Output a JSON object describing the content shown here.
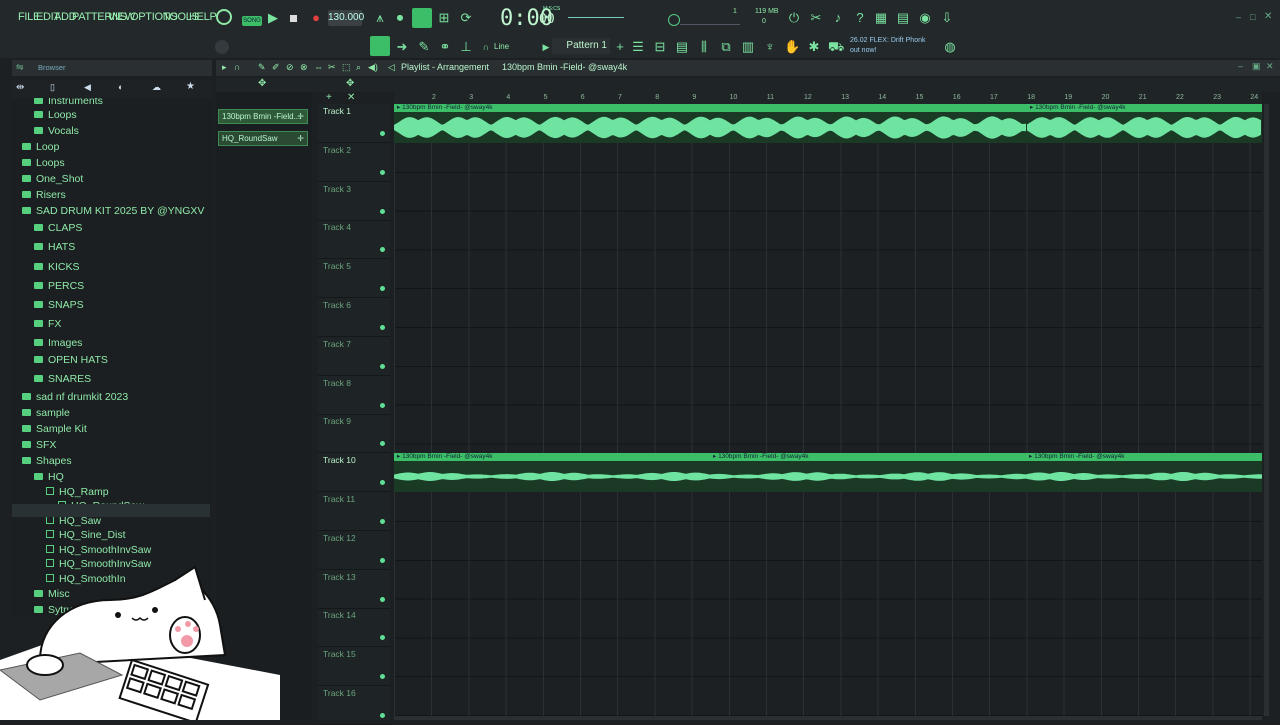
{
  "menu": [
    "FILE",
    "EDIT",
    "ADD",
    "PATTERNS",
    "VIEW",
    "OPTIONS",
    "TOOLS",
    "HELP"
  ],
  "transport": {
    "tempo": "130.000",
    "time": "0:00",
    "time_small": "00",
    "time_unit": "M:S:CS",
    "cpu": "119 MB",
    "cpu_small": "0",
    "beat": "1",
    "beat2": "0"
  },
  "pattern": "Pattern 1",
  "snap": "Line",
  "news": {
    "line1": "26.02  FLEX: Drift Phonk",
    "line2": "out now!"
  },
  "browser": {
    "title": "Browser",
    "items": [
      {
        "label": "Instruments",
        "indent": 1,
        "type": "folder"
      },
      {
        "label": "Loops",
        "indent": 1,
        "type": "folder"
      },
      {
        "label": "Vocals",
        "indent": 1,
        "type": "folder"
      },
      {
        "label": "Loop",
        "indent": 0,
        "type": "folder"
      },
      {
        "label": "Loops",
        "indent": 0,
        "type": "folder"
      },
      {
        "label": "One_Shot",
        "indent": 0,
        "type": "folder"
      },
      {
        "label": "Risers",
        "indent": 0,
        "type": "folder"
      },
      {
        "label": "SAD DRUM KIT 2025 BY @YNGXV",
        "indent": 0,
        "type": "folder"
      },
      {
        "label": "CLAPS",
        "indent": 1,
        "type": "folder"
      },
      {
        "label": "HATS",
        "indent": 1,
        "type": "folder"
      },
      {
        "label": "KICKS",
        "indent": 1,
        "type": "folder"
      },
      {
        "label": "PERCS",
        "indent": 1,
        "type": "folder"
      },
      {
        "label": "SNAPS",
        "indent": 1,
        "type": "folder"
      },
      {
        "label": "FX",
        "indent": 1,
        "type": "folder"
      },
      {
        "label": "Images",
        "indent": 1,
        "type": "folder"
      },
      {
        "label": "OPEN HATS",
        "indent": 1,
        "type": "folder"
      },
      {
        "label": "SNARES",
        "indent": 1,
        "type": "folder"
      },
      {
        "label": "sad nf drumkit 2023",
        "indent": 0,
        "type": "folder"
      },
      {
        "label": "sample",
        "indent": 0,
        "type": "folder"
      },
      {
        "label": "Sample Kit",
        "indent": 0,
        "type": "folder"
      },
      {
        "label": "SFX",
        "indent": 0,
        "type": "folder"
      },
      {
        "label": "Shapes",
        "indent": 0,
        "type": "folder"
      },
      {
        "label": "HQ",
        "indent": 1,
        "type": "folder"
      },
      {
        "label": "HQ_Ramp",
        "indent": 2,
        "type": "file"
      },
      {
        "label": "HQ_RoundSaw",
        "indent": 3,
        "type": "file"
      },
      {
        "label": "HQ_Saw",
        "indent": 2,
        "type": "file"
      },
      {
        "label": "HQ_Sine_Dist",
        "indent": 2,
        "type": "file"
      },
      {
        "label": "HQ_SmoothInvSaw",
        "indent": 2,
        "type": "file"
      },
      {
        "label": "HQ_SmoothInvSaw",
        "indent": 2,
        "type": "file"
      },
      {
        "label": "HQ_SmoothIn",
        "indent": 2,
        "type": "file"
      },
      {
        "label": "Misc",
        "indent": 1,
        "type": "folder"
      },
      {
        "label": "Sytrus",
        "indent": 1,
        "type": "folder"
      }
    ]
  },
  "playlist": {
    "title": "Playlist - Arrangement",
    "crumb": "130bpm Bmin -Field- @sway4k",
    "picker": [
      "130bpm Bmin -Field...",
      "HQ_RoundSaw"
    ],
    "ruler": [
      "2",
      "3",
      "4",
      "5",
      "6",
      "7",
      "8",
      "9",
      "10",
      "11",
      "12",
      "13",
      "14",
      "15",
      "16",
      "17",
      "18",
      "19",
      "20",
      "21",
      "22",
      "23",
      "24"
    ],
    "tracks": [
      "Track 1",
      "Track 2",
      "Track 3",
      "Track 4",
      "Track 5",
      "Track 6",
      "Track 7",
      "Track 8",
      "Track 9",
      "Track 10",
      "Track 11",
      "Track 12",
      "Track 13",
      "Track 14",
      "Track 15",
      "Track 16"
    ],
    "clip_label": "130bpm Bmin -Field- @sway4k"
  },
  "accent": "#3cbd68"
}
